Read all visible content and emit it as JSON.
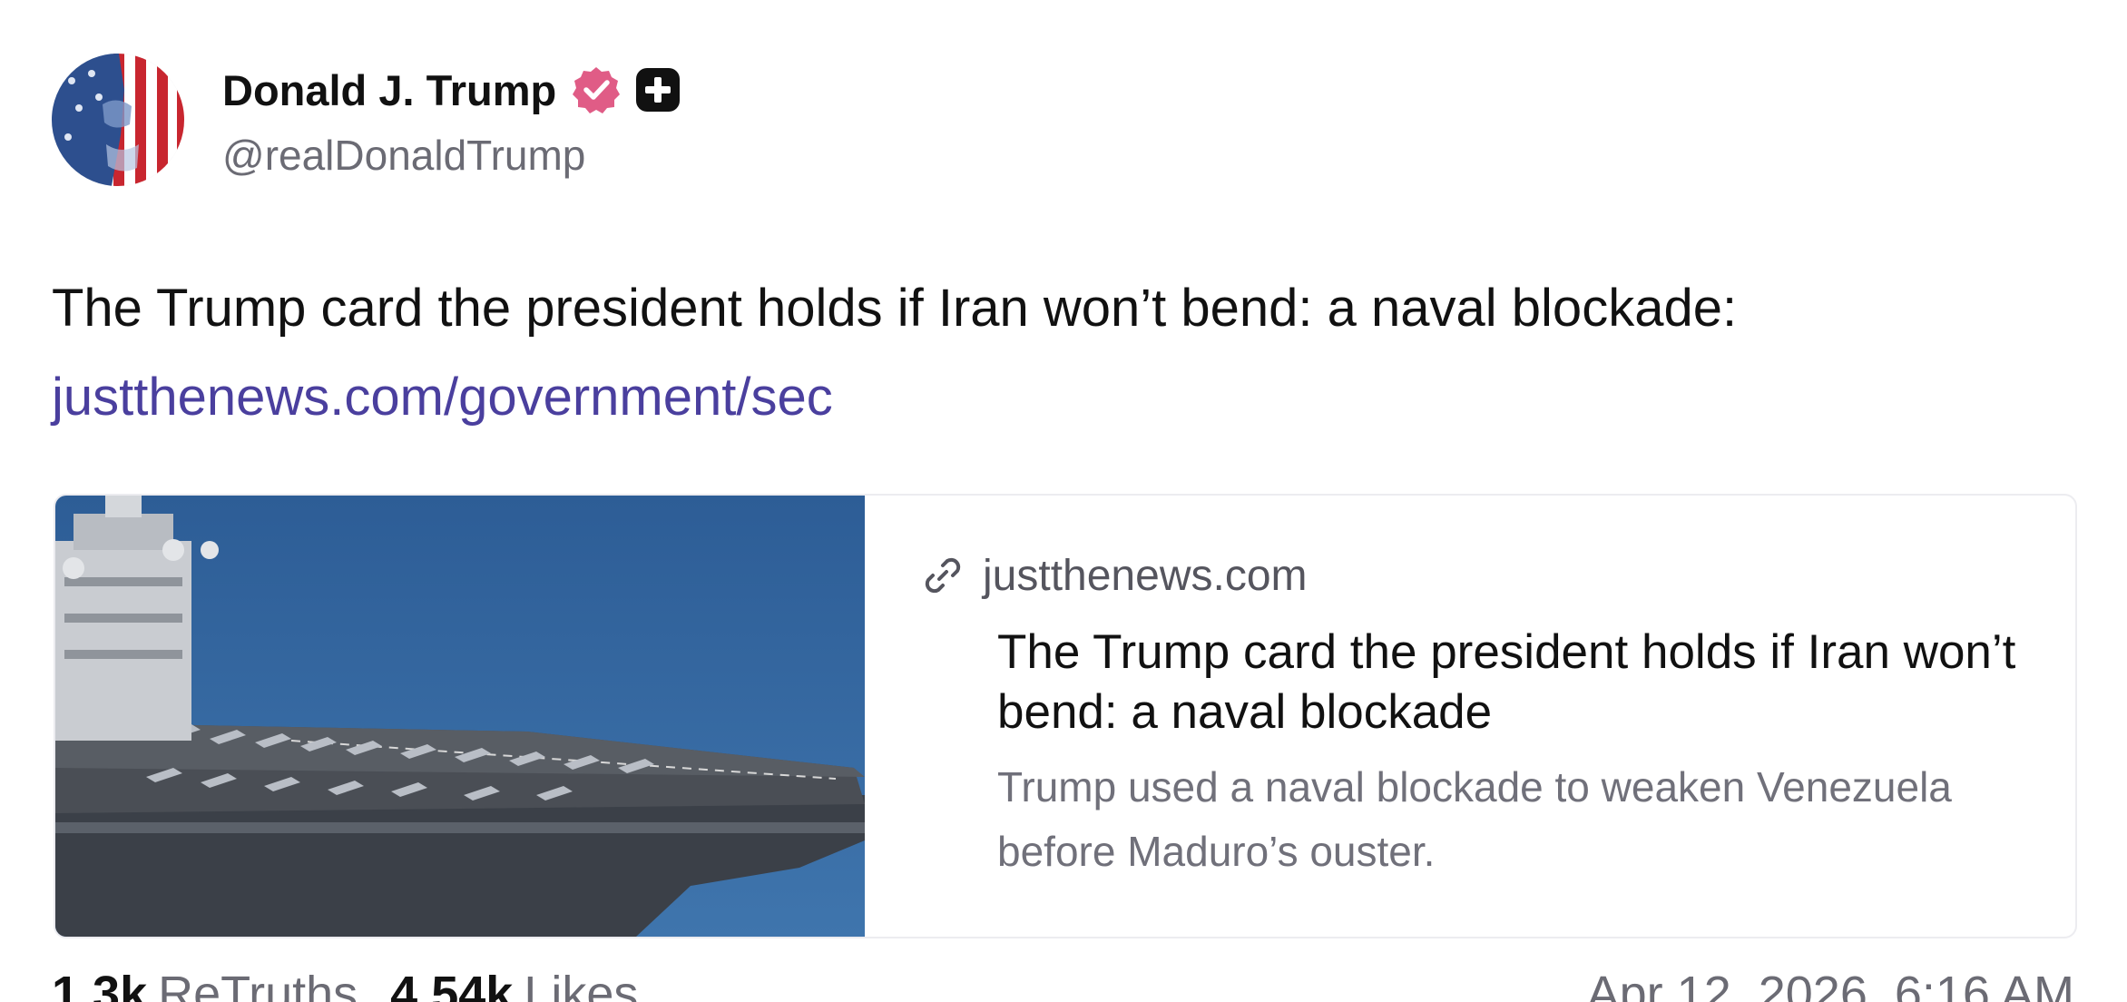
{
  "author": {
    "display_name": "Donald J. Trump",
    "handle": "@realDonaldTrump",
    "avatar_icon": "avatar-flag-portrait",
    "verified_icon": "verified-badge-icon",
    "verified_color": "#e05c86",
    "extra_badge_icon": "plus-badge-icon"
  },
  "post": {
    "text": "The Trump card the president holds if Iran won’t bend: a naval blockade:",
    "link_text": "justthenews.com/government/sec",
    "link_color": "#4a3f9e"
  },
  "link_card": {
    "domain": "justthenews.com",
    "title": "The Trump card the president holds if Iran won’t bend: a naval blockade",
    "description": "Trump used a naval blockade to weaken Venezuela before Maduro’s ouster.",
    "image_alt": "aircraft-carrier-photo",
    "link_icon": "link-icon"
  },
  "stats": {
    "retruths_count": "1.3k",
    "retruths_label": "ReTruths",
    "likes_count": "4.54k",
    "likes_label": "Likes",
    "timestamp": "Apr 12, 2026, 6:16 AM"
  }
}
